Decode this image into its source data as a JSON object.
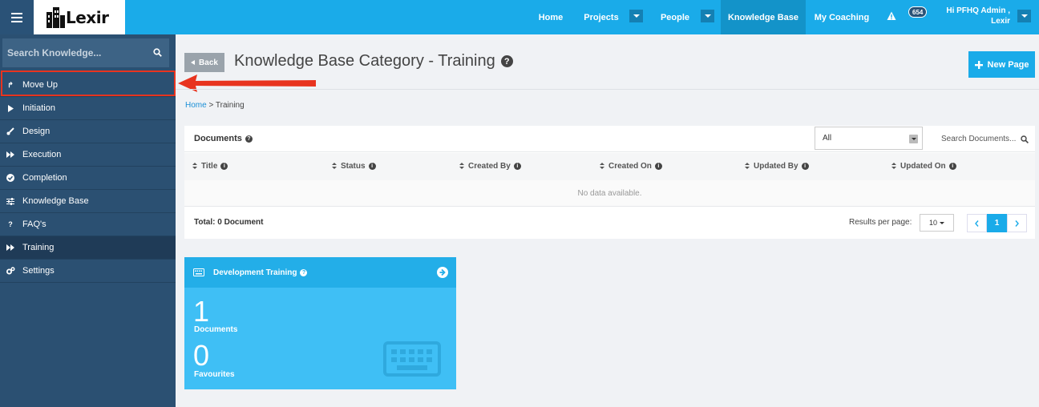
{
  "app": {
    "logo_text": "Lexir"
  },
  "topnav": {
    "home": "Home",
    "projects": "Projects",
    "people": "People",
    "knowledge_base": "Knowledge Base",
    "my_coaching": "My Coaching",
    "notification_count": "654",
    "user_line1": "Hi PFHQ Admin ,",
    "user_line2": "Lexir"
  },
  "sidebar": {
    "search_placeholder": "Search Knowledge...",
    "items": [
      {
        "label": "Move Up",
        "icon": "level-up-icon"
      },
      {
        "label": "Initiation",
        "icon": "play-icon"
      },
      {
        "label": "Design",
        "icon": "brush-icon"
      },
      {
        "label": "Execution",
        "icon": "fast-forward-icon"
      },
      {
        "label": "Completion",
        "icon": "check-circle-icon"
      },
      {
        "label": "Knowledge Base",
        "icon": "sliders-icon"
      },
      {
        "label": "FAQ's",
        "icon": "question-icon"
      },
      {
        "label": "Training",
        "icon": "fast-forward-icon"
      },
      {
        "label": "Settings",
        "icon": "cogs-icon"
      }
    ]
  },
  "header": {
    "back_label": "Back",
    "title": "Knowledge Base Category - Training",
    "new_page_label": "New Page"
  },
  "breadcrumb": {
    "home": "Home",
    "separator": ">",
    "current": "Training"
  },
  "documents": {
    "label": "Documents",
    "filter_value": "All",
    "search_placeholder": "Search Documents...",
    "columns": [
      "Title",
      "Status",
      "Created By",
      "Created On",
      "Updated By",
      "Updated On"
    ],
    "empty_text": "No data available.",
    "total": "Total: 0 Document",
    "results_per_page_label": "Results per page:",
    "results_per_page_value": "10",
    "current_page": "1"
  },
  "card": {
    "title": "Development Training",
    "documents_count": "1",
    "documents_label": "Documents",
    "favourites_count": "0",
    "favourites_label": "Favourites"
  },
  "colors": {
    "topbar": "#1aabe9",
    "sidebar": "#2b5072",
    "highlight": "#e8341f"
  }
}
